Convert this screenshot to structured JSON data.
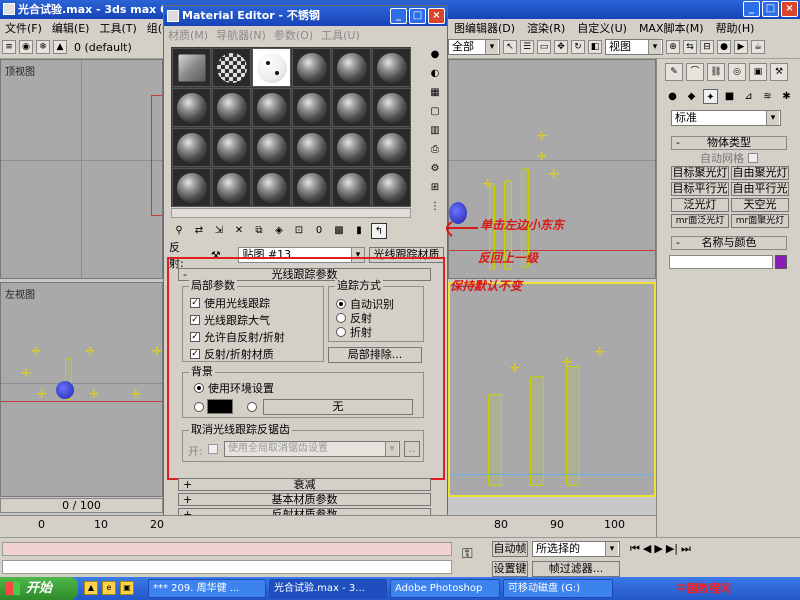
{
  "max": {
    "title": "光合试验.max - 3ds max 6",
    "menu_left": [
      "文件(F)",
      "编辑(E)",
      "工具(T)",
      "组(G)"
    ],
    "menu_right": [
      "图编辑器(D)",
      "渲染(R)",
      "自定义(U)",
      "MAX脚本(M)",
      "帮助(H)"
    ],
    "layer": "0 (default)",
    "selection_combo": "全部",
    "view_combo": "视图",
    "viewports": {
      "top": "顶视图",
      "left": "左视图"
    }
  },
  "command_panel": {
    "category": "标准",
    "object_type_title": "物体类型",
    "auto_grid": "自动网格",
    "buttons": [
      "目标聚光灯",
      "自由聚光灯",
      "目标平行光",
      "自由平行光",
      "泛光灯",
      "天空光",
      "mr面泛光灯",
      "mr面聚光灯"
    ],
    "name_color_title": "名称与颜色"
  },
  "material_editor": {
    "title": "Material Editor - 不锈钢",
    "menu": [
      "材质(M)",
      "导航器(N)",
      "参数(O)",
      "工具(U)"
    ],
    "reflect_label": "反射:",
    "map_name": "贴图 #13",
    "map_type_button": "光线跟踪材质",
    "rollout_raytrace": "光线跟踪参数",
    "local_params": {
      "title": "局部参数",
      "items": [
        {
          "label": "使用光线跟踪",
          "checked": true
        },
        {
          "label": "光线跟踪大气",
          "checked": true
        },
        {
          "label": "允许自反射/折射",
          "checked": true
        },
        {
          "label": "反射/折射材质",
          "checked": true
        }
      ]
    },
    "trace_mode": {
      "title": "追踪方式",
      "options": [
        {
          "label": "自动识别",
          "selected": true
        },
        {
          "label": "反射",
          "selected": false
        },
        {
          "label": "折射",
          "selected": false
        }
      ]
    },
    "local_exclude_button": "局部排除...",
    "background": {
      "title": "背景",
      "use_env_label": "使用环境设置",
      "swatch_color": "#000000",
      "map_button": "无"
    },
    "antialias": {
      "title": "取消光线跟踪反锯齿",
      "on_label": "开:",
      "combo_value": "使用全局取消锯齿设置",
      "more_button": ".."
    },
    "collapsed_rollouts": [
      "衰减",
      "基本材质参数",
      "反射材质参数"
    ]
  },
  "annotation": {
    "line1": "单击左边小东东",
    "line2": "反回上一级",
    "line3": "保持默认不变",
    "color": "#d81818"
  },
  "timeline": {
    "frame_counter": "0 / 100",
    "ticks": [
      "0",
      "10",
      "20",
      "80",
      "90",
      "100"
    ]
  },
  "status": {
    "auto_key": "自动帧",
    "selected_combo": "所选择的",
    "set_key": "设置键",
    "key_filters": "帧过滤器..."
  },
  "taskbar": {
    "start": "开始",
    "tasks": [
      "*** 209. 周华健 ...",
      "光合试验.max - 3...",
      "Adobe Photoshop",
      "可移动磁盘 (G:)"
    ]
  },
  "watermark": "中国教程网 www.agwon.com"
}
